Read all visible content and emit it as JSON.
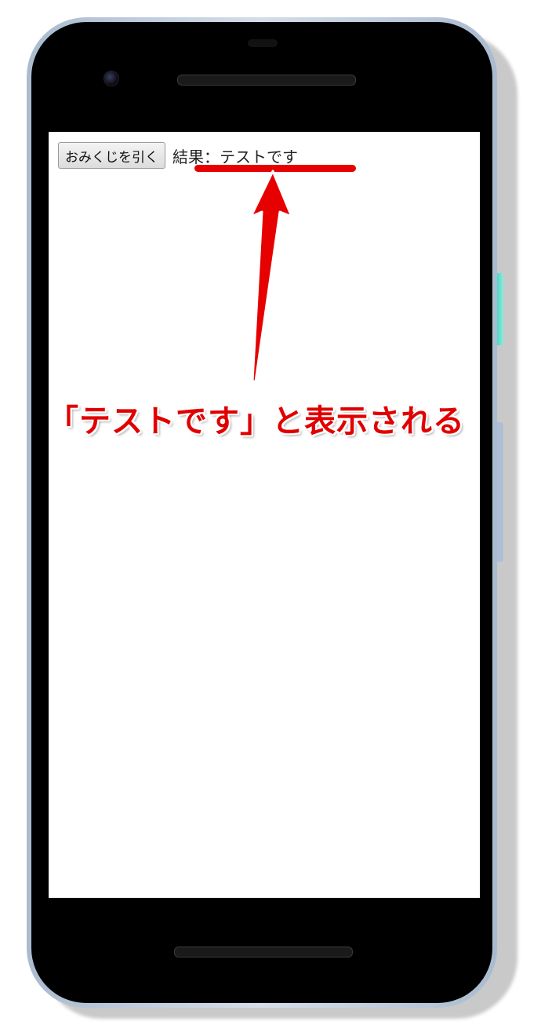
{
  "app": {
    "button_label": "おみくじを引く",
    "result_text": "結果：テストです"
  },
  "annotation": {
    "callout_text": "「テストです」と表示される",
    "accent_color": "#e60000"
  },
  "device": {
    "frame_color": "#b4c4d8",
    "accent_button_color": "#1dc9b5"
  }
}
